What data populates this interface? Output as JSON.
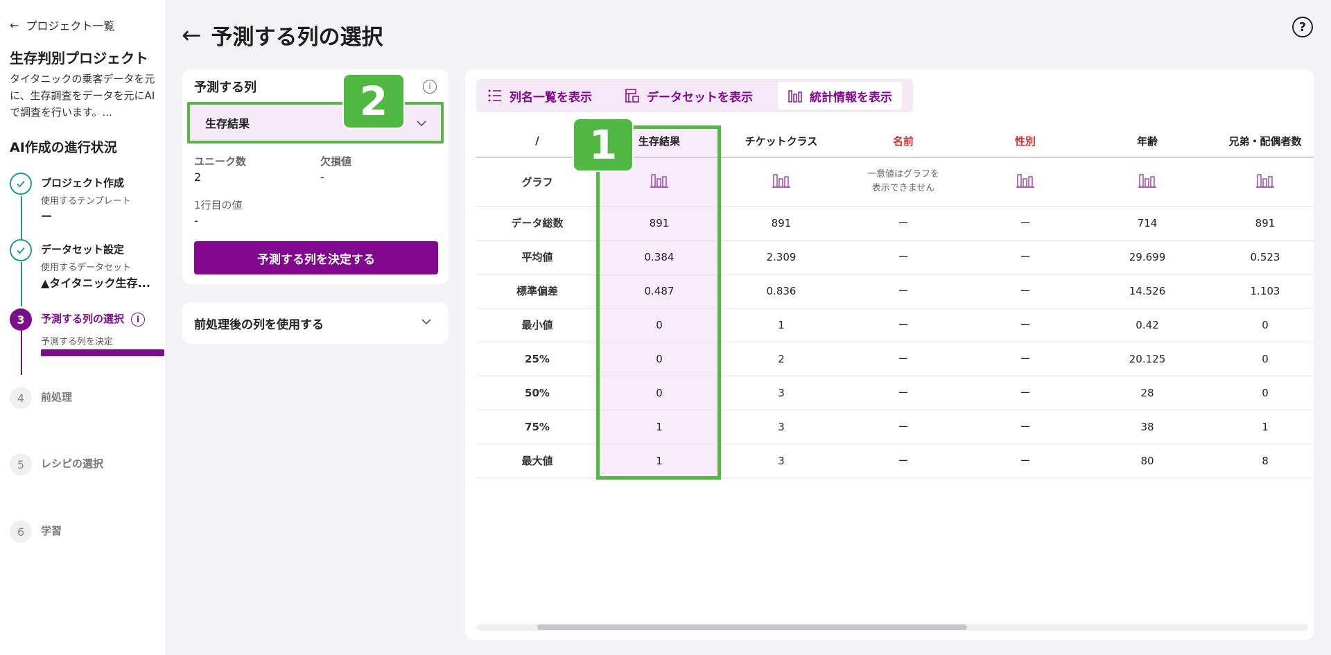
{
  "sidebar": {
    "back_label": "プロジェクト一覧",
    "project_title": "生存判別プロジェクト",
    "project_desc": "タイタニックの乗客データを元に、生存調査をデータを元にAIで調査を行います。...",
    "progress_title": "AI作成の進行状況",
    "steps": [
      {
        "number": "1",
        "name": "プロジェクト作成",
        "sub": "使用するテンプレート",
        "value": "ー",
        "status": "done"
      },
      {
        "number": "2",
        "name": "データセット設定",
        "sub": "使用するデータセット",
        "value": "▲タイタニック生存...",
        "status": "done"
      },
      {
        "number": "3",
        "name": "予測する列の選択",
        "sub": "予測する列を決定",
        "status": "active",
        "progress": 1.0
      },
      {
        "number": "4",
        "name": "前処理",
        "status": "todo"
      },
      {
        "number": "5",
        "name": "レシピの選択",
        "status": "todo"
      },
      {
        "number": "6",
        "name": "学習",
        "status": "todo"
      }
    ]
  },
  "header": {
    "title": "予測する列の選択"
  },
  "target_panel": {
    "title": "予測する列",
    "selected": "生存結果",
    "unique_label": "ユニーク数",
    "unique_value": "2",
    "missing_label": "欠損値",
    "missing_value": "-",
    "first_row_label": "1行目の値",
    "first_row_value": "-",
    "decide_button": "予測する列を決定する"
  },
  "preprocess_panel": {
    "label": "前処理後の列を使用する"
  },
  "tabs": [
    {
      "label": "列名一覧を表示",
      "icon": "list-icon"
    },
    {
      "label": "データセットを表示",
      "icon": "dataset-icon"
    },
    {
      "label": "統計情報を表示",
      "icon": "bar-chart-icon",
      "selected": true
    }
  ],
  "table": {
    "corner": "/",
    "columns": [
      "生存結果",
      "チケットクラス",
      "名前",
      "性別",
      "年齢",
      "兄弟・配偶者数"
    ],
    "red_columns": [
      "名前",
      "性別"
    ],
    "graph_row_label": "グラフ",
    "nograph_text": [
      "一意値はグラフを",
      "表示できません"
    ],
    "rows": [
      {
        "label": "データ総数",
        "values": [
          "891",
          "891",
          "ー",
          "ー",
          "714",
          "891"
        ]
      },
      {
        "label": "平均値",
        "values": [
          "0.384",
          "2.309",
          "ー",
          "ー",
          "29.699",
          "0.523"
        ]
      },
      {
        "label": "標準偏差",
        "values": [
          "0.487",
          "0.836",
          "ー",
          "ー",
          "14.526",
          "1.103"
        ]
      },
      {
        "label": "最小値",
        "values": [
          "0",
          "1",
          "ー",
          "ー",
          "0.42",
          "0"
        ]
      },
      {
        "label": "25%",
        "values": [
          "0",
          "2",
          "ー",
          "ー",
          "20.125",
          "0"
        ]
      },
      {
        "label": "50%",
        "values": [
          "0",
          "3",
          "ー",
          "ー",
          "28",
          "0"
        ]
      },
      {
        "label": "75%",
        "values": [
          "1",
          "3",
          "ー",
          "ー",
          "38",
          "1"
        ]
      },
      {
        "label": "最大値",
        "values": [
          "1",
          "3",
          "ー",
          "ー",
          "80",
          "8"
        ]
      }
    ]
  },
  "annotations": {
    "badge1": "1",
    "badge2": "2"
  },
  "colors": {
    "accent": "#82078f",
    "highlight": "#55b843",
    "done": "#1a9b8d",
    "warning_text": "#d0312d"
  }
}
